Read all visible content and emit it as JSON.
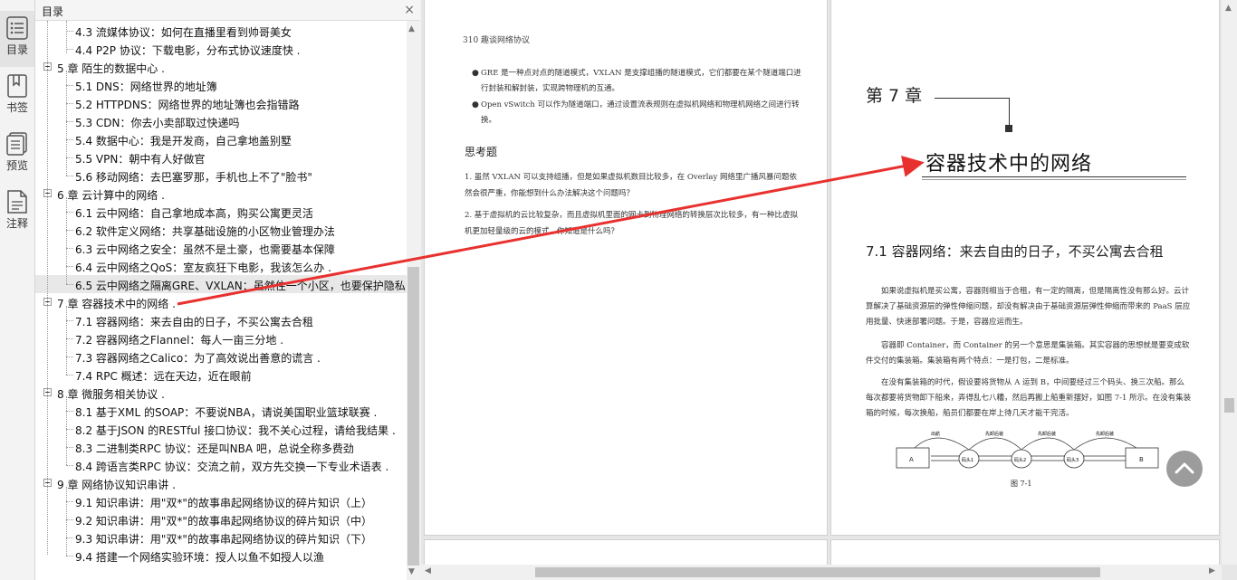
{
  "rail": {
    "items": [
      {
        "label": "目录",
        "icon": "toc-list-icon"
      },
      {
        "label": "书签",
        "icon": "bookmark-icon"
      },
      {
        "label": "预览",
        "icon": "preview-icon"
      },
      {
        "label": "注释",
        "icon": "annotation-icon"
      }
    ]
  },
  "toc": {
    "title": "目录",
    "close": "×",
    "items": [
      {
        "level": 2,
        "text": "4.3 流媒体协议：如何在直播里看到帅哥美女"
      },
      {
        "level": 2,
        "text": "4.4 P2P 协议：下载电影，分布式协议速度快 ."
      },
      {
        "level": 1,
        "text": "5 章 陌生的数据中心 ."
      },
      {
        "level": 2,
        "text": "5.1 DNS：网络世界的地址簿"
      },
      {
        "level": 2,
        "text": "5.2 HTTPDNS：网络世界的地址簿也会指错路"
      },
      {
        "level": 2,
        "text": "5.3 CDN：你去小卖部取过快递吗"
      },
      {
        "level": 2,
        "text": "5.4 数据中心：我是开发商，自己拿地盖别墅"
      },
      {
        "level": 2,
        "text": "5.5 VPN：朝中有人好做官"
      },
      {
        "level": 2,
        "text": "5.6 移动网络：去巴塞罗那，手机也上不了\"脸书\""
      },
      {
        "level": 1,
        "text": "6 章 云计算中的网络 ."
      },
      {
        "level": 2,
        "text": "6.1 云中网络：自己拿地成本高，购买公寓更灵活"
      },
      {
        "level": 2,
        "text": "6.2 软件定义网络：共享基础设施的小区物业管理办法"
      },
      {
        "level": 2,
        "text": "6.3 云中网络之安全：虽然不是土豪，也需要基本保障"
      },
      {
        "level": 2,
        "text": "6.4 云中网络之QoS：室友疯狂下电影，我该怎么办 ."
      },
      {
        "level": 2,
        "text": "6.5 云中网络之隔离GRE、VXLAN：虽然住一个小区，也要保护隐私",
        "selected": true
      },
      {
        "level": 1,
        "text": "7 章 容器技术中的网络 ."
      },
      {
        "level": 2,
        "text": "7.1 容器网络：来去自由的日子，不买公寓去合租"
      },
      {
        "level": 2,
        "text": "7.2 容器网络之Flannel：每人一亩三分地 ."
      },
      {
        "level": 2,
        "text": "7.3 容器网络之Calico：为了高效说出善意的谎言 ."
      },
      {
        "level": 2,
        "text": "7.4 RPC 概述：远在天边，近在眼前"
      },
      {
        "level": 1,
        "text": "8 章 微服务相关协议 ."
      },
      {
        "level": 2,
        "text": "8.1 基于XML 的SOAP：不要说NBA，请说美国职业篮球联赛 ."
      },
      {
        "level": 2,
        "text": "8.2 基于JSON 的RESTful 接口协议：我不关心过程，请给我结果 ."
      },
      {
        "level": 2,
        "text": "8.3 二进制类RPC 协议：还是叫NBA 吧，总说全称多费劲"
      },
      {
        "level": 2,
        "text": "8.4 跨语言类RPC 协议：交流之前，双方先交换一下专业术语表 ."
      },
      {
        "level": 1,
        "text": "9 章 网络协议知识串讲 ."
      },
      {
        "level": 2,
        "text": "9.1 知识串讲：用\"双*\"的故事串起网络协议的碎片知识（上）"
      },
      {
        "level": 2,
        "text": "9.2 知识串讲：用\"双*\"的故事串起网络协议的碎片知识（中）"
      },
      {
        "level": 2,
        "text": "9.3 知识串讲：用\"双*\"的故事串起网络协议的碎片知识（下）"
      },
      {
        "level": 2,
        "text": "9.4 搭建一个网络实验环境：授人以鱼不如授人以渔"
      }
    ]
  },
  "page_left": {
    "header": "310  趣谈网络协议",
    "bullets": [
      "GRE 是一种点对点的隧道模式，VXLAN 是支撑组播的隧道模式，它们都要在某个隧道端口进行封装和解封装，实现跨物理机的互通。",
      "Open vSwitch 可以作为隧道端口，通过设置流表规则在虚拟机网络和物理机网络之间进行转换。"
    ],
    "questions_title": "思考题",
    "questions": [
      "1. 虽然 VXLAN 可以支持组播，但是如果虚拟机数目比较多，在 Overlay 网络里广播风暴问题依然会很严重，你能想到什么办法解决这个问题吗？",
      "2. 基于虚拟机的云比较复杂，而且虚拟机里面的网卡到物理网络的转换层次比较多，有一种比虚拟机更加轻量级的云的模式，你知道是什么吗？"
    ]
  },
  "page_right": {
    "chapter_label": "第 7 章",
    "chapter_title": "容器技术中的网络",
    "section_title": "7.1   容器网络：来去自由的日子，不买公寓去合租",
    "paragraphs": [
      "如果说虚拟机是买公寓，容器则相当于合租，有一定的隔离，但是隔离性没有那么好。云计算解决了基础资源层的弹性伸缩问题，却没有解决由于基础资源层弹性伸缩而带来的 PaaS 层应用批量、快速部署问题。于是，容器应运而生。",
      "容器即 Container，而 Container 的另一个意思是集装箱。其实容器的思想就是要变成软件交付的集装箱。集装箱有两个特点：一是打包，二是标准。",
      "在没有集装箱的时代，假设要将货物从 A 运到 B，中间要经过三个码头、换三次船。那么每次都要将货物卸下船来，弄得乱七八糟，然后再搬上船重新摆好，如图 7-1 所示。在没有集装箱的时候，每次换船，船员们都要在岸上待几天才能干完活。"
    ],
    "figure": {
      "start": "A",
      "end": "B",
      "ports": [
        "码头1",
        "码头2",
        "码头3"
      ],
      "arcs": [
        "出航",
        "先卸后装",
        "先卸后装",
        "先卸后装"
      ],
      "caption": "图 7-1"
    }
  },
  "colors": {
    "arrow": "#e8312f",
    "selected_row": "#e8e8e8"
  }
}
